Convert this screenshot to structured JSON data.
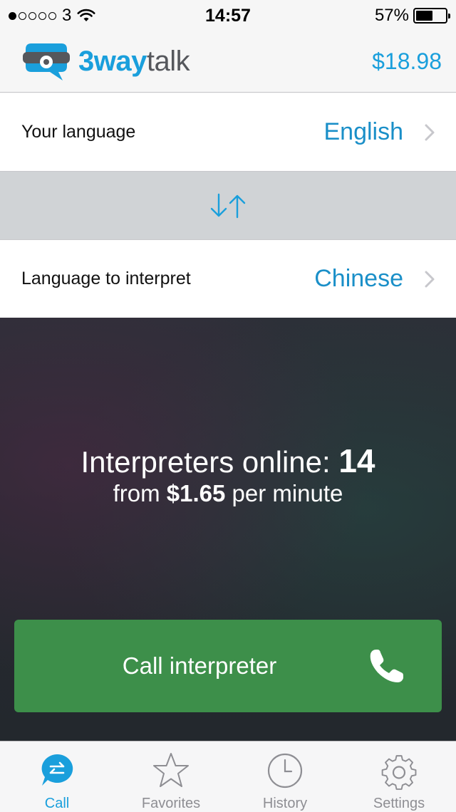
{
  "status_bar": {
    "carrier": "3",
    "time": "14:57",
    "battery_percent": "57%",
    "battery_level": 0.57,
    "signal_bars_filled": 1,
    "signal_bars_total": 5
  },
  "header": {
    "logo_brand": "3way",
    "logo_suffix": "talk",
    "balance": "$18.98"
  },
  "languages": {
    "your_language_label": "Your language",
    "your_language_value": "English",
    "interpret_label": "Language to interpret",
    "interpret_value": "Chinese"
  },
  "info": {
    "online_label": "Interpreters online:",
    "online_count": "14",
    "price_prefix": "from",
    "price_amount": "$1.65",
    "price_suffix": "per minute"
  },
  "call_button": {
    "label": "Call interpreter"
  },
  "tabs": [
    {
      "label": "Call",
      "icon": "call-bubble-icon",
      "active": true
    },
    {
      "label": "Favorites",
      "icon": "star-icon",
      "active": false
    },
    {
      "label": "History",
      "icon": "clock-icon",
      "active": false
    },
    {
      "label": "Settings",
      "icon": "gear-icon",
      "active": false
    }
  ],
  "colors": {
    "accent": "#1a9fdc",
    "call_green": "#3d8f4a",
    "dark_bg": "#262b31"
  }
}
